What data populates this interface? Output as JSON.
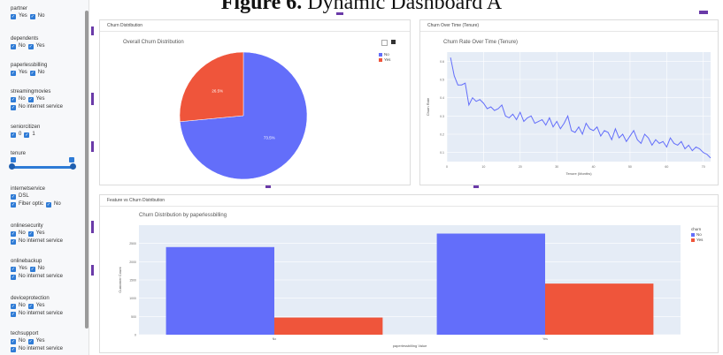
{
  "figure_title_bold": "Figure 6.",
  "figure_title_rest": "Dynamic Dashboard A",
  "sidebar": {
    "filters": [
      {
        "label": "partner",
        "options": [
          "Yes",
          "No"
        ]
      },
      {
        "label": "dependents",
        "options": [
          "No",
          "Yes"
        ]
      },
      {
        "label": "paperlessbilling",
        "options": [
          "Yes",
          "No"
        ]
      },
      {
        "label": "streamingmovies",
        "options": [
          "No",
          "Yes",
          "No internet service"
        ]
      },
      {
        "label": "seniorcitizen",
        "options": [
          "0",
          "1"
        ]
      },
      {
        "label": "tenure",
        "slider": {
          "min": 0,
          "max": 72,
          "low": 0,
          "high": 72
        }
      },
      {
        "label": "internetservice",
        "options": [
          "DSL",
          "Fiber optic",
          "No"
        ]
      },
      {
        "label": "onlinesecurity",
        "options": [
          "No",
          "Yes",
          "No internet service"
        ]
      },
      {
        "label": "onlinebackup",
        "options": [
          "Yes",
          "No",
          "No internet service"
        ]
      },
      {
        "label": "deviceprotection",
        "options": [
          "No",
          "Yes",
          "No internet service"
        ]
      },
      {
        "label": "techsupport",
        "options": [
          "No",
          "Yes",
          "No internet service"
        ]
      }
    ]
  },
  "panels": {
    "churn_distribution": {
      "header": "Churn Distribution",
      "plot_title": "Overall Churn Distribution"
    },
    "churn_over_time": {
      "header": "Churn Over Time (Tenure)",
      "plot_title": "Churn Rate Over Time (Tenure)"
    },
    "feature_vs_churn": {
      "header": "Feature vs Churn Distribution",
      "plot_title": "Churn Distribution by paperlessbilling"
    }
  },
  "colors": {
    "no": "#636efa",
    "yes": "#ef553b",
    "grid_bg": "#e5ecf6",
    "accent": "#2e7bd6"
  },
  "chart_data": [
    {
      "type": "pie",
      "title": "Overall Churn Distribution",
      "labels": [
        "No",
        "Yes"
      ],
      "values": [
        73.5,
        26.5
      ],
      "slice_labels": [
        "73.5%",
        "26.5%"
      ],
      "legend": [
        "No",
        "Yes"
      ],
      "legend_placement": "top-right"
    },
    {
      "type": "line",
      "title": "Churn Rate Over Time (Tenure)",
      "xlabel": "Tenure (Months)",
      "ylabel": "Churn Rate",
      "x_ticks": [
        "0",
        "10",
        "20",
        "30",
        "40",
        "50",
        "60",
        "70"
      ],
      "y_ticks": [
        "0.1",
        "0.2",
        "0.3",
        "0.4",
        "0.5",
        "0.6"
      ],
      "xlim": [
        0,
        72
      ],
      "ylim": [
        0.05,
        0.65
      ],
      "grid": true,
      "x": [
        1,
        2,
        3,
        4,
        5,
        6,
        7,
        8,
        9,
        10,
        11,
        12,
        13,
        14,
        15,
        16,
        17,
        18,
        19,
        20,
        21,
        22,
        23,
        24,
        25,
        26,
        27,
        28,
        29,
        30,
        31,
        32,
        33,
        34,
        35,
        36,
        37,
        38,
        39,
        40,
        41,
        42,
        43,
        44,
        45,
        46,
        47,
        48,
        49,
        50,
        51,
        52,
        53,
        54,
        55,
        56,
        57,
        58,
        59,
        60,
        61,
        62,
        63,
        64,
        65,
        66,
        67,
        68,
        69,
        70,
        71,
        72
      ],
      "y": [
        0.62,
        0.52,
        0.47,
        0.47,
        0.48,
        0.36,
        0.4,
        0.38,
        0.39,
        0.37,
        0.34,
        0.35,
        0.33,
        0.34,
        0.36,
        0.3,
        0.29,
        0.31,
        0.28,
        0.32,
        0.27,
        0.29,
        0.3,
        0.26,
        0.27,
        0.28,
        0.25,
        0.29,
        0.24,
        0.27,
        0.23,
        0.26,
        0.3,
        0.22,
        0.21,
        0.24,
        0.2,
        0.26,
        0.23,
        0.22,
        0.24,
        0.19,
        0.22,
        0.21,
        0.17,
        0.23,
        0.18,
        0.2,
        0.16,
        0.19,
        0.22,
        0.17,
        0.15,
        0.2,
        0.18,
        0.14,
        0.17,
        0.15,
        0.16,
        0.13,
        0.18,
        0.15,
        0.14,
        0.16,
        0.12,
        0.14,
        0.11,
        0.13,
        0.12,
        0.1,
        0.09,
        0.07
      ]
    },
    {
      "type": "bar",
      "title": "Churn Distribution by paperlessbilling",
      "categories": [
        "No",
        "Yes"
      ],
      "series": [
        {
          "name": "No",
          "values": [
            2400,
            2770
          ]
        },
        {
          "name": "Yes",
          "values": [
            470,
            1400
          ]
        }
      ],
      "xlabel": "paperlessbilling Value",
      "ylabel": "Customer Count",
      "y_ticks": [
        "0",
        "500",
        "1000",
        "1500",
        "2000",
        "2500"
      ],
      "ylim": [
        0,
        3000
      ],
      "legend_title": "churn",
      "legend": [
        "No",
        "Yes"
      ],
      "legend_placement": "top-right",
      "grid": true
    }
  ]
}
